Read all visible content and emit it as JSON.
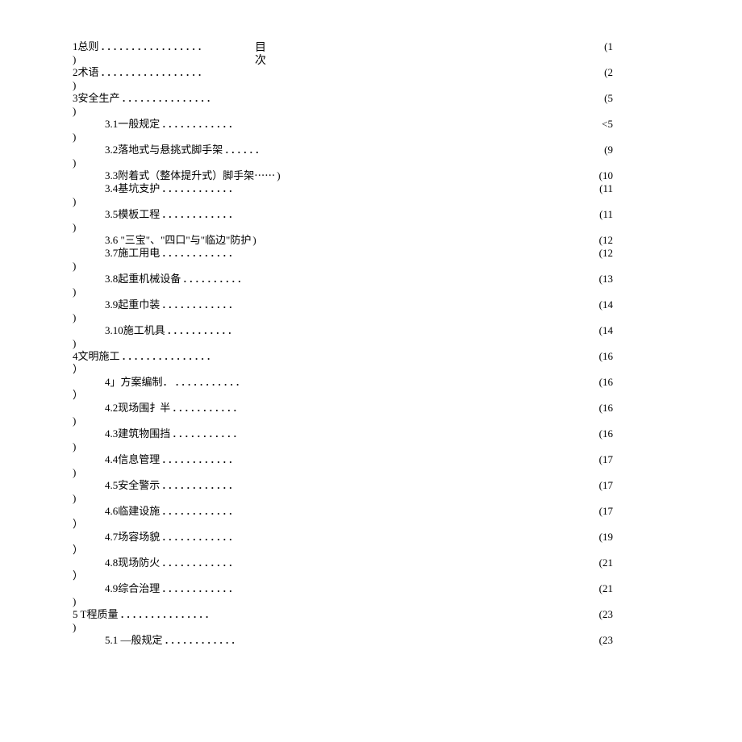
{
  "title": "目次",
  "entries": [
    {
      "level": 0,
      "label": "1总则",
      "dots": "．．．．．．．．．．．．．．．．．",
      "page": "(1",
      "close": ")"
    },
    {
      "level": 0,
      "label": "2术语",
      "dots": "．．．．．．．．．．．．．．．．．",
      "page": "(2",
      "close": ")"
    },
    {
      "level": 0,
      "label": "3安全生产",
      "dots": "．．．．．．．．．．．．．．．",
      "page": "(5",
      "close": ")"
    },
    {
      "level": 1,
      "label": "3.1一般规定",
      "dots": "．．．．．．．．．．．．",
      "page": "<5",
      "close": ")"
    },
    {
      "level": 1,
      "label": "3.2落地式与悬挑式脚手架",
      "dots": "．．．．．．",
      "page": "(9",
      "close": ")"
    },
    {
      "level": 1,
      "label": "3.3附着式（整体提升式）脚手架⋯⋯",
      "dots": " )",
      "page": "(10",
      "close": ""
    },
    {
      "level": 1,
      "label": "3.4基坑支护",
      "dots": "．．．．．．．．．．．．",
      "page": "(11",
      "close": ")"
    },
    {
      "level": 1,
      "label": "3.5模板工程",
      "dots": "．．．．．．．．．．．．",
      "page": "(11",
      "close": ")"
    },
    {
      "level": 1,
      "label": "3.6 \"三宝\"、\"四口\"与\"临边\"防护",
      "dots": " )",
      "page": "(12",
      "close": ""
    },
    {
      "level": 1,
      "label": "3.7施工用电",
      "dots": "．．．．．．．．．．．．",
      "page": "(12",
      "close": ")"
    },
    {
      "level": 1,
      "label": "3.8起重机械设备",
      "dots": "．．．．．．．．．．",
      "page": "(13",
      "close": ")"
    },
    {
      "level": 1,
      "label": "3.9起重巾装",
      "dots": "．．．．．．．．．．．．",
      "page": "(14",
      "close": ")"
    },
    {
      "level": 1,
      "label": "3.10施工机具",
      "dots": "．．．．．．．．．．．",
      "page": "(14",
      "close": ")"
    },
    {
      "level": 0,
      "label": "4文明施工",
      "dots": "．．．．．．．．．．．．．．．",
      "page": "(16",
      "close": "）"
    },
    {
      "level": 1,
      "label": "4」方案编制．",
      "dots": "．．．．．．．．．．．",
      "page": "(16",
      "close": "）"
    },
    {
      "level": 1,
      "label": "4.2现场围扌半",
      "dots": "．．．．．．．．．．．",
      "page": "(16",
      "close": ")"
    },
    {
      "level": 1,
      "label": "4.3建筑物围挡",
      "dots": "．．．．．．．．．．．",
      "page": "(16",
      "close": ")"
    },
    {
      "level": 1,
      "label": "4.4信息管理",
      "dots": "．．．．．．．．．．．．",
      "page": "(17",
      "close": ")"
    },
    {
      "level": 1,
      "label": "4.5安全警示",
      "dots": "．．．．．．．．．．．．",
      "page": "(17",
      "close": ")"
    },
    {
      "level": 1,
      "label": "4.6临建设施",
      "dots": "．．．．．．．．．．．．",
      "page": "(17",
      "close": "）"
    },
    {
      "level": 1,
      "label": "4.7场容场貌",
      "dots": "．．．．．．．．．．．．",
      "page": "(19",
      "close": "）"
    },
    {
      "level": 1,
      "label": "4.8现场防火",
      "dots": "．．．．．．．．．．．．",
      "page": "(21",
      "close": "）"
    },
    {
      "level": 1,
      "label": "4.9综合治理",
      "dots": "．．．．．．．．．．．．",
      "page": "(21",
      "close": ")"
    },
    {
      "level": 0,
      "label": "5 T程质量",
      "dots": "．．．．．．．．．．．．．．．",
      "page": "(23",
      "close": ")"
    },
    {
      "level": 1,
      "label": "5.1 —般规定",
      "dots": "．．．．．．．．．．．．",
      "page": "(23",
      "close": ""
    }
  ]
}
